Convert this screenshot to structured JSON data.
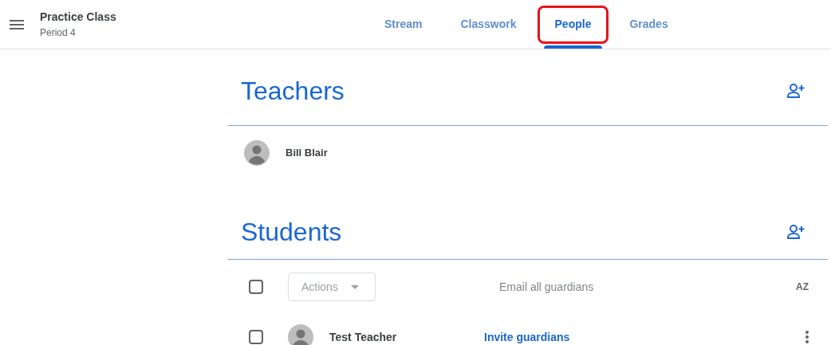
{
  "header": {
    "title": "Practice Class",
    "subtitle": "Period 4"
  },
  "tabs": [
    {
      "label": "Stream",
      "selected": false,
      "annotated": false
    },
    {
      "label": "Classwork",
      "selected": false,
      "annotated": false
    },
    {
      "label": "People",
      "selected": true,
      "annotated": true
    },
    {
      "label": "Grades",
      "selected": false,
      "annotated": false
    }
  ],
  "teachers": {
    "heading": "Teachers",
    "people": [
      {
        "name": "Bill Blair"
      }
    ]
  },
  "students": {
    "heading": "Students",
    "actions_label": "Actions",
    "email_all": "Email all guardians",
    "sort_label": "AZ",
    "select_all_checked": false,
    "people": [
      {
        "name": "Test Teacher",
        "checked": false,
        "invite": "Invite guardians"
      }
    ]
  }
}
